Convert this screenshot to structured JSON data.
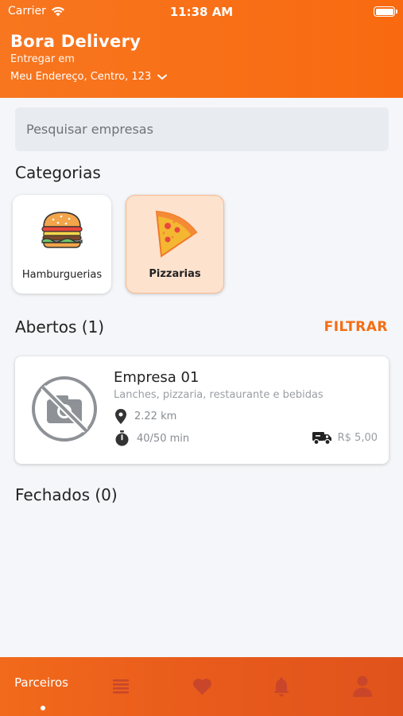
{
  "status_bar": {
    "carrier": "Carrier",
    "time": "11:38 AM"
  },
  "header": {
    "title": "Bora Delivery",
    "deliver_label": "Entregar em",
    "address": "Meu Endereço, Centro, 123"
  },
  "search": {
    "placeholder": "Pesquisar empresas",
    "value": ""
  },
  "categories": {
    "title": "Categorias",
    "items": [
      {
        "label": "Hamburguerias",
        "icon": "burger-icon",
        "selected": false
      },
      {
        "label": "Pizzarias",
        "icon": "pizza-icon",
        "selected": true
      }
    ]
  },
  "open_section": {
    "title": "Abertos (1)",
    "filter_label": "FILTRAR"
  },
  "companies": [
    {
      "name": "Empresa 01",
      "description": "Lanches, pizzaria, restaurante e bebidas",
      "distance": "2.22 km",
      "delivery_time": "40/50 min",
      "delivery_fee": "R$ 5,00"
    }
  ],
  "closed_section": {
    "title": "Fechados (0)"
  },
  "bottom_nav": {
    "active_label": "Parceiros",
    "items": [
      "Parceiros",
      "list-icon",
      "heart-icon",
      "bell-icon",
      "user-icon"
    ]
  },
  "colors": {
    "accent": "#f46e13",
    "header": "#f7761f",
    "selected_category_bg": "#fde2ce"
  }
}
